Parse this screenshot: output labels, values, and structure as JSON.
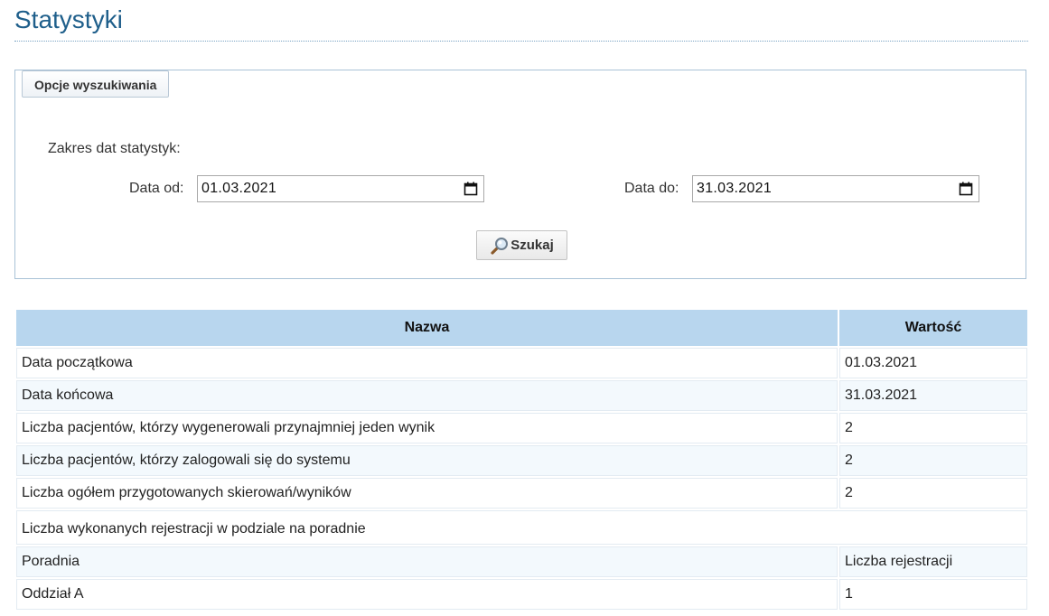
{
  "page": {
    "title": "Statystyki"
  },
  "search": {
    "legend": "Opcje wyszukiwania",
    "range_label": "Zakres dat statystyk:",
    "date_from_label": "Data od:",
    "date_from_value": "01.03.2021",
    "date_to_label": "Data do:",
    "date_to_value": "31.03.2021",
    "search_button": "Szukaj"
  },
  "table": {
    "headers": [
      "Nazwa",
      "Wartość"
    ],
    "rows": [
      {
        "name": "Data początkowa",
        "value": "01.03.2021"
      },
      {
        "name": "Data końcowa",
        "value": "31.03.2021"
      },
      {
        "name": "Liczba pacjentów, którzy wygenerowali przynajmniej jeden wynik",
        "value": "2"
      },
      {
        "name": "Liczba pacjentów, którzy zalogowali się do systemu",
        "value": "2"
      },
      {
        "name": "Liczba ogółem przygotowanych skierowań/wyników",
        "value": "2"
      }
    ],
    "section_title": "Liczba wykonanych rejestracji w podziale na poradnie",
    "sub_headers": [
      "Poradnia",
      "Liczba rejestracji"
    ],
    "sub_rows": [
      {
        "name": "Oddział A",
        "value": "1"
      }
    ]
  },
  "icons": {
    "calendar": "calendar-icon",
    "search": "magnifier-icon"
  },
  "colors": {
    "title": "#1f5f8b",
    "table_header": "#b8d6ee",
    "row_alt": "#f3f9fd"
  }
}
